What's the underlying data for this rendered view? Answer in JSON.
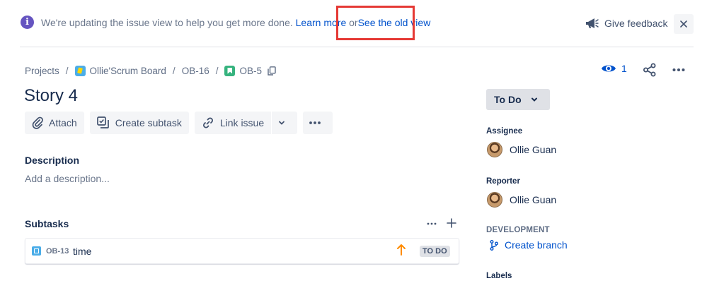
{
  "banner": {
    "message": "We're updating the issue view to help you get more done.",
    "learn_more": "Learn more",
    "or": "or",
    "old_view_link": "See the old view",
    "feedback_label": "Give feedback"
  },
  "breadcrumb": {
    "projects": "Projects",
    "board": "Ollie'Scrum Board",
    "parent_key": "OB-16",
    "issue_key": "OB-5"
  },
  "watchers": {
    "count": "1"
  },
  "issue": {
    "title": "Story 4"
  },
  "toolbar": {
    "attach": "Attach",
    "create_subtask": "Create subtask",
    "link_issue": "Link issue"
  },
  "description": {
    "label": "Description",
    "placeholder": "Add a description..."
  },
  "subtasks": {
    "label": "Subtasks",
    "items": [
      {
        "key": "OB-13",
        "name": "time",
        "priority": "High",
        "status": "TO DO"
      }
    ]
  },
  "sidebar": {
    "status": "To Do",
    "assignee_label": "Assignee",
    "assignee": "Ollie Guan",
    "reporter_label": "Reporter",
    "reporter": "Ollie Guan",
    "development_label": "DEVELOPMENT",
    "create_branch": "Create branch",
    "labels_label": "Labels"
  },
  "colors": {
    "accent": "#0052CC",
    "highlight": "#E53935",
    "info": "#6554C0",
    "priority_high": "#FF8B00"
  }
}
